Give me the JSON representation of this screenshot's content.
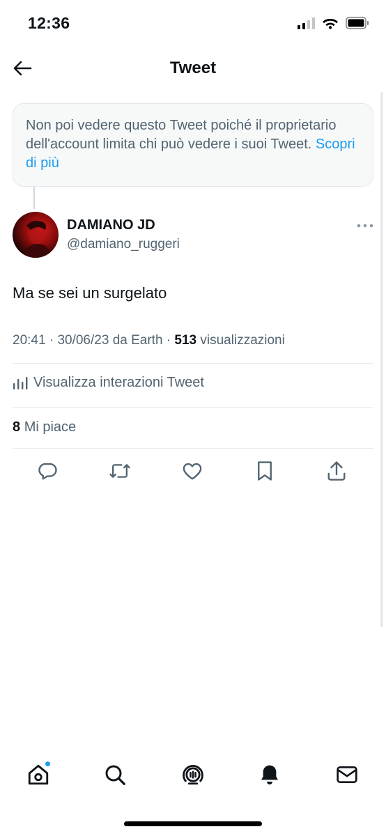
{
  "status_bar": {
    "time": "12:36"
  },
  "header": {
    "title": "Tweet"
  },
  "notice": {
    "text": "Non poi vedere questo Tweet poiché il proprietario dell'account limita chi può vedere i suoi Tweet.",
    "link": "Scopri di più"
  },
  "tweet": {
    "author_name": "DAMIANO JD",
    "author_handle": "@damiano_ruggeri",
    "text": "Ma se sei un surgelato",
    "time": "20:41",
    "date": "30/06/23",
    "source": "da Earth",
    "views_count": "513",
    "views_label": "visualizzazioni",
    "analytics_label": "Visualizza interazioni Tweet",
    "likes_count": "8",
    "likes_label": "Mi piace"
  },
  "colors": {
    "accent": "#1d9bf0",
    "secondary_text": "#536471",
    "primary_text": "#0f1419"
  },
  "icons": {
    "actions": [
      "reply-icon",
      "retweet-icon",
      "like-icon",
      "bookmark-icon",
      "share-icon"
    ],
    "tabs": [
      "home-icon",
      "search-icon",
      "spaces-icon",
      "notifications-icon",
      "messages-icon"
    ]
  }
}
